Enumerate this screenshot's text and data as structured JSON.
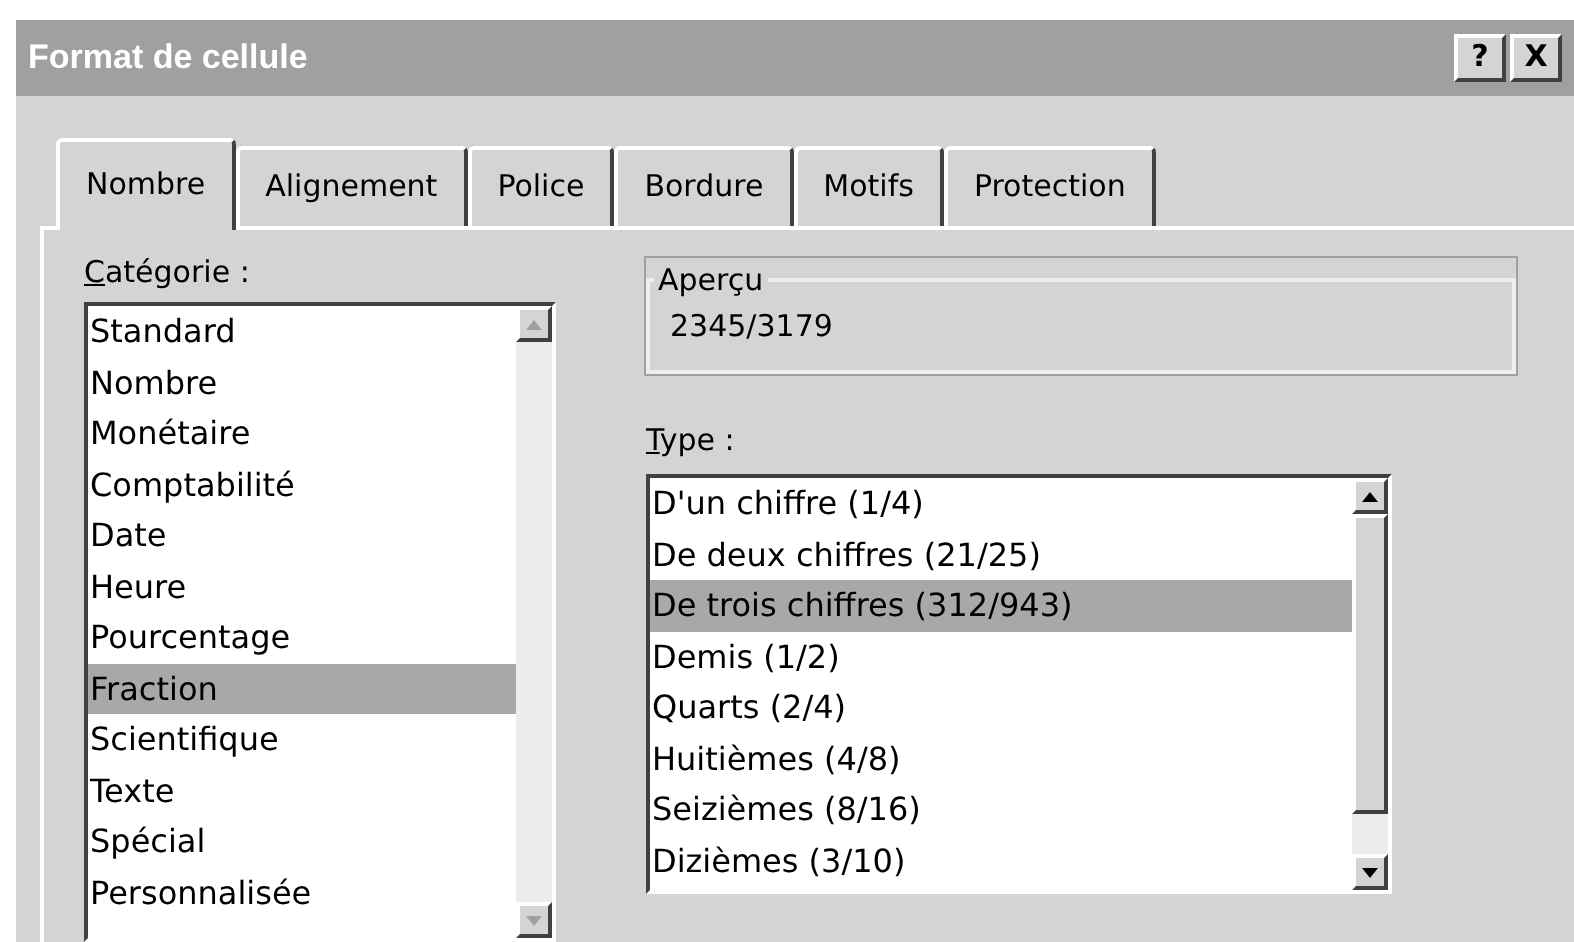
{
  "window": {
    "title": "Format de cellule",
    "buttons": [
      "?",
      "X"
    ]
  },
  "tabs": [
    {
      "label": "Nombre",
      "selected": true
    },
    {
      "label": "Alignement",
      "selected": false
    },
    {
      "label": "Police",
      "selected": false
    },
    {
      "label": "Bordure",
      "selected": false
    },
    {
      "label": "Motifs",
      "selected": false
    },
    {
      "label": "Protection",
      "selected": false
    }
  ],
  "category": {
    "label": "Catégorie :",
    "items": [
      {
        "label": "Standard",
        "selected": false
      },
      {
        "label": "Nombre",
        "selected": false
      },
      {
        "label": "Monétaire",
        "selected": false
      },
      {
        "label": "Comptabilité",
        "selected": false
      },
      {
        "label": "Date",
        "selected": false
      },
      {
        "label": "Heure",
        "selected": false
      },
      {
        "label": "Pourcentage",
        "selected": false
      },
      {
        "label": "Fraction",
        "selected": true
      },
      {
        "label": "Scientifique",
        "selected": false
      },
      {
        "label": "Texte",
        "selected": false
      },
      {
        "label": "Spécial",
        "selected": false
      },
      {
        "label": "Personnalisée",
        "selected": false
      }
    ]
  },
  "preview": {
    "label": "Aperçu",
    "value": "2345/3179"
  },
  "type": {
    "label": "Type :",
    "items": [
      {
        "label": "D'un chiffre (1/4)",
        "selected": false
      },
      {
        "label": "De deux chiffres (21/25)",
        "selected": false
      },
      {
        "label": "De trois chiffres (312/943)",
        "selected": true
      },
      {
        "label": "Demis (1/2)",
        "selected": false
      },
      {
        "label": "Quarts (2/4)",
        "selected": false
      },
      {
        "label": "Huitièmes (4/8)",
        "selected": false
      },
      {
        "label": "Seizièmes (8/16)",
        "selected": false
      },
      {
        "label": "Dizièmes (3/10)",
        "selected": false
      }
    ]
  }
}
